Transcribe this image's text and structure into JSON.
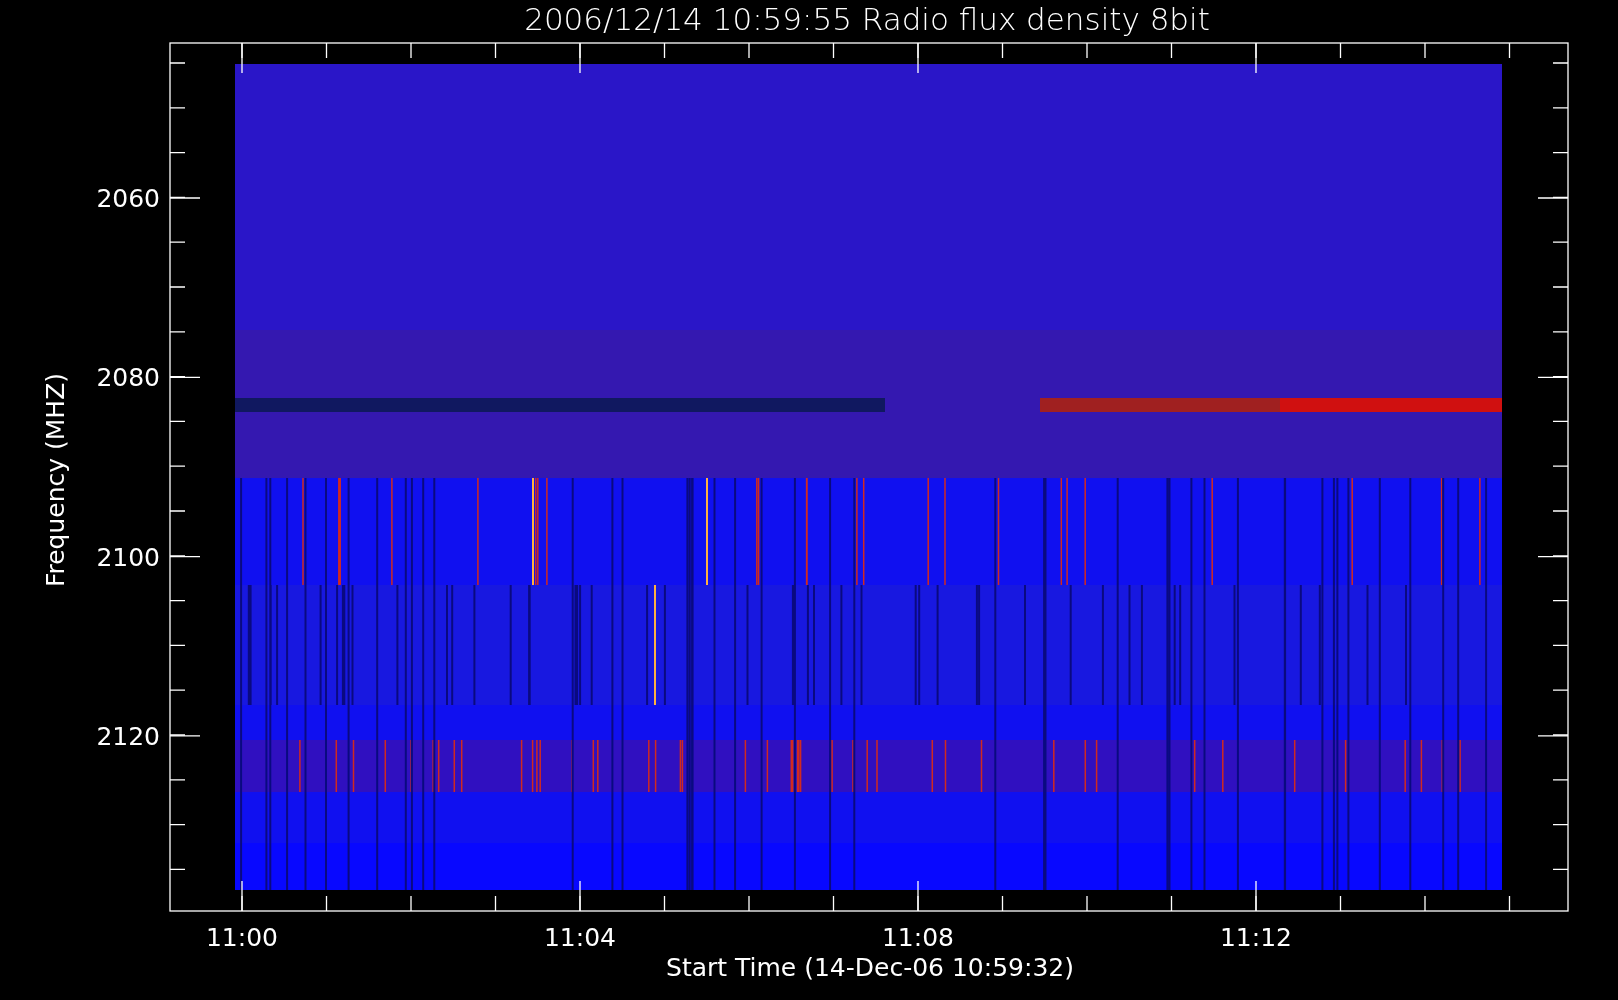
{
  "title": "2006/12/14 10:59:55 Radio flux density 8bit",
  "y_axis": {
    "label": "Frequency (MHZ)",
    "ticks": [
      "2060",
      "2080",
      "2100",
      "2120"
    ]
  },
  "x_axis": {
    "label": "Start Time (14-Dec-06 10:59:32)",
    "ticks": [
      "11:00",
      "11:04",
      "11:08",
      "11:12"
    ]
  }
}
